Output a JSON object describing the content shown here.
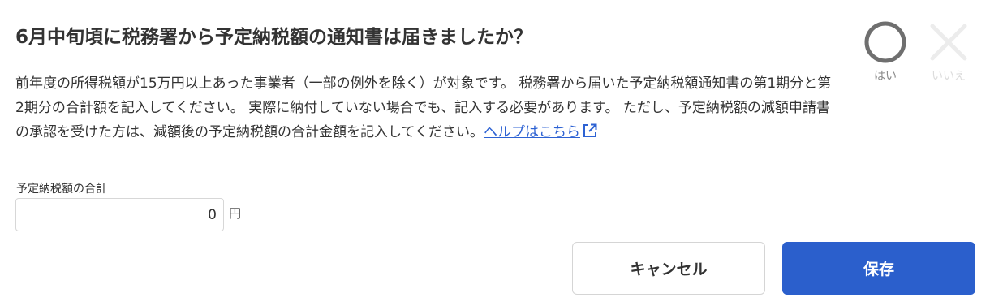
{
  "question": {
    "title": "6月中旬頃に税務署から予定納税額の通知書は届きましたか？",
    "description": "前年度の所得税額が15万円以上あった事業者（一部の例外を除く）が対象です。 税務署から届いた予定納税額通知書の第1期分と第2期分の合計額を記入してください。 実際に納付していない場合でも、記入する必要があります。 ただし、予定納税額の減額申請書の承認を受けた方は、減額後の予定納税額の合計金額を記入してください。",
    "help_link": "ヘルプはこちら",
    "help_link_icon": "external-link-icon"
  },
  "answers": {
    "yes_label": "はい",
    "yes_icon": "circle-icon",
    "no_label": "いいえ",
    "no_icon": "cross-icon",
    "selected": "yes"
  },
  "form": {
    "field_label": "予定納税額の合計",
    "amount_value": "0",
    "unit": "円"
  },
  "buttons": {
    "cancel_label": "キャンセル",
    "save_label": "保存"
  },
  "colors": {
    "accent": "#2b5fcc",
    "link": "#2d62d3",
    "selected_icon": "#6f6f6f",
    "unselected_icon": "#ececec"
  }
}
